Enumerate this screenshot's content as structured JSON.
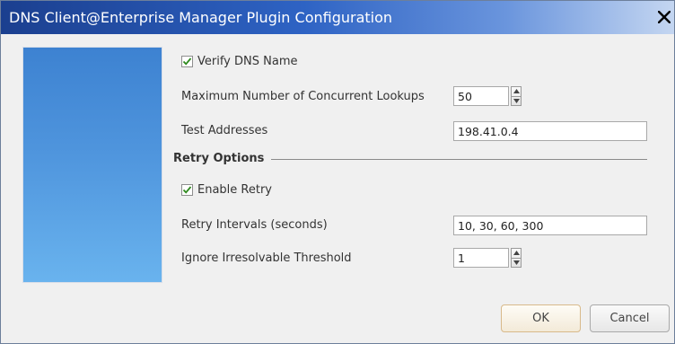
{
  "dialog": {
    "title": "DNS Client@Enterprise Manager Plugin Configuration",
    "close_icon": "close-icon"
  },
  "form": {
    "verify_dns": {
      "label": "Verify DNS Name",
      "checked": true
    },
    "max_lookups": {
      "label": "Maximum Number of Concurrent Lookups",
      "value": "50"
    },
    "test_addresses": {
      "label": "Test Addresses",
      "value": "198.41.0.4"
    },
    "retry_options": {
      "title": "Retry Options",
      "enable_retry": {
        "label": "Enable Retry",
        "checked": true
      },
      "retry_intervals": {
        "label": "Retry Intervals (seconds)",
        "value": "10, 30, 60, 300"
      },
      "ignore_threshold": {
        "label": "Ignore Irresolvable Threshold",
        "value": "1"
      }
    }
  },
  "buttons": {
    "ok": "OK",
    "cancel": "Cancel"
  },
  "colors": {
    "titlebar_start": "#1b3f8f",
    "titlebar_end": "#c4d6f1",
    "side_panel": "#4f95dd",
    "check_mark": "#2f8a1e"
  }
}
